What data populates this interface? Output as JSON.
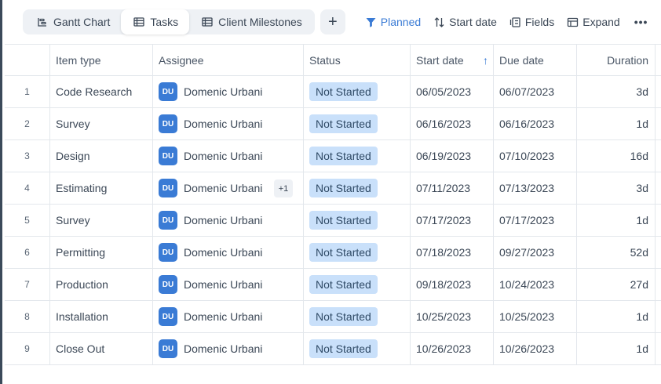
{
  "colors": {
    "accent": "#3a7bd5",
    "status_not_started_bg": "#c9e0fa",
    "avatar_bg": "#3a7bd5"
  },
  "toolbar": {
    "tabs": [
      {
        "label": "Gantt Chart",
        "icon": "gantt-icon"
      },
      {
        "label": "Tasks",
        "icon": "table-icon",
        "active": true
      },
      {
        "label": "Client Milestones",
        "icon": "table-icon"
      }
    ],
    "add_label": "+",
    "planned_label": "Planned",
    "start_date_label": "Start date",
    "fields_label": "Fields",
    "expand_label": "Expand",
    "more_label": "•••"
  },
  "columns": {
    "item_type": "Item type",
    "assignee": "Assignee",
    "status": "Status",
    "start_date": "Start date",
    "due_date": "Due date",
    "duration": "Duration"
  },
  "rows": [
    {
      "num": "1",
      "item_type": "Code Research",
      "avatar": "DU",
      "assignee": "Domenic Urbani",
      "extra": "",
      "status": "Not Started",
      "start": "06/05/2023",
      "due": "06/07/2023",
      "duration": "3d"
    },
    {
      "num": "2",
      "item_type": "Survey",
      "avatar": "DU",
      "assignee": "Domenic Urbani",
      "extra": "",
      "status": "Not Started",
      "start": "06/16/2023",
      "due": "06/16/2023",
      "duration": "1d"
    },
    {
      "num": "3",
      "item_type": "Design",
      "avatar": "DU",
      "assignee": "Domenic Urbani",
      "extra": "",
      "status": "Not Started",
      "start": "06/19/2023",
      "due": "07/10/2023",
      "duration": "16d"
    },
    {
      "num": "4",
      "item_type": "Estimating",
      "avatar": "DU",
      "assignee": "Domenic Urbani",
      "extra": "+1",
      "status": "Not Started",
      "start": "07/11/2023",
      "due": "07/13/2023",
      "duration": "3d"
    },
    {
      "num": "5",
      "item_type": "Survey",
      "avatar": "DU",
      "assignee": "Domenic Urbani",
      "extra": "",
      "status": "Not Started",
      "start": "07/17/2023",
      "due": "07/17/2023",
      "duration": "1d"
    },
    {
      "num": "6",
      "item_type": "Permitting",
      "avatar": "DU",
      "assignee": "Domenic Urbani",
      "extra": "",
      "status": "Not Started",
      "start": "07/18/2023",
      "due": "09/27/2023",
      "duration": "52d"
    },
    {
      "num": "7",
      "item_type": "Production",
      "avatar": "DU",
      "assignee": "Domenic Urbani",
      "extra": "",
      "status": "Not Started",
      "start": "09/18/2023",
      "due": "10/24/2023",
      "duration": "27d"
    },
    {
      "num": "8",
      "item_type": "Installation",
      "avatar": "DU",
      "assignee": "Domenic Urbani",
      "extra": "",
      "status": "Not Started",
      "start": "10/25/2023",
      "due": "10/25/2023",
      "duration": "1d"
    },
    {
      "num": "9",
      "item_type": "Close Out",
      "avatar": "DU",
      "assignee": "Domenic Urbani",
      "extra": "",
      "status": "Not Started",
      "start": "10/26/2023",
      "due": "10/26/2023",
      "duration": "1d"
    }
  ]
}
